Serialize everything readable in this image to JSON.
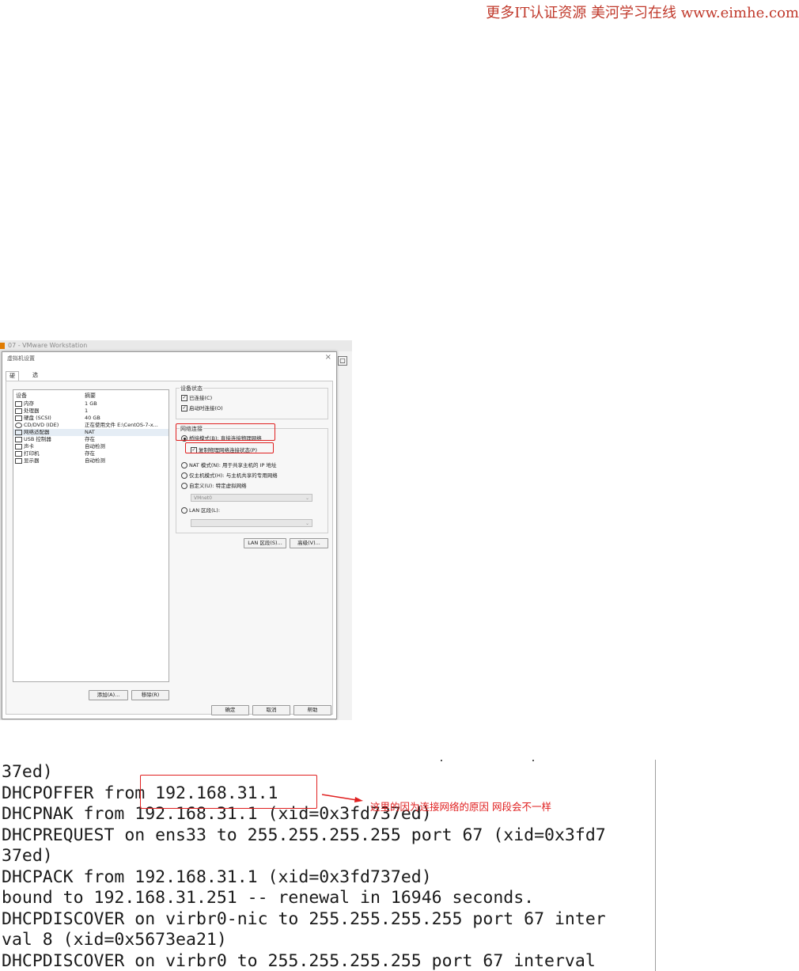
{
  "watermark": "更多IT认证资源 美河学习在线 www.eimhe.com",
  "vmware": {
    "window_title": "07 - VMware Workstation",
    "dialog_title": "虚拟机设置",
    "tabs": [
      "硬件",
      "选项"
    ],
    "device_header": "设备",
    "summary_header": "摘要",
    "devices": [
      {
        "name": "内存",
        "summary": "1 GB",
        "icon": "memory-icon"
      },
      {
        "name": "处理器",
        "summary": "1",
        "icon": "cpu-icon"
      },
      {
        "name": "硬盘 (SCSI)",
        "summary": "40 GB",
        "icon": "hard-disk-icon"
      },
      {
        "name": "CD/DVD (IDE)",
        "summary": "正在使用文件 E:\\CentOS-7-x...",
        "icon": "cd-dvd-icon"
      },
      {
        "name": "网络适配器",
        "summary": "NAT",
        "icon": "network-adapter-icon",
        "selected": true
      },
      {
        "name": "USB 控制器",
        "summary": "存在",
        "icon": "usb-icon"
      },
      {
        "name": "声卡",
        "summary": "自动检测",
        "icon": "sound-card-icon"
      },
      {
        "name": "打印机",
        "summary": "存在",
        "icon": "printer-icon"
      },
      {
        "name": "显示器",
        "summary": "自动检测",
        "icon": "display-icon"
      }
    ],
    "add_button": "添加(A)...",
    "remove_button": "移除(R)",
    "device_status": {
      "label": "设备状态",
      "connected": "已连接(C)",
      "connect_at_power_on": "启动时连接(O)"
    },
    "network_connection": {
      "label": "网络连接",
      "bridged": "桥接模式(B): 直接连接物理网络",
      "replicate": "复制物理网络连接状态(P)",
      "nat": "NAT 模式(N): 用于共享主机的 IP 地址",
      "host_only": "仅主机模式(H): 与主机共享的专用网络",
      "custom": "自定义(U): 特定虚拟网络",
      "custom_value": "VMnet0",
      "lan_segment": "LAN 区段(L):"
    },
    "lan_segments_button": "LAN 区段(S)...",
    "advanced_button": "高级(V)...",
    "ok_button": "确定",
    "cancel_button": "取消",
    "help_button": "帮助"
  },
  "terminal": {
    "lines": [
      "37ed)",
      "DHCPOFFER from 192.168.31.1",
      "DHCPNAK from 192.168.31.1 (xid=0x3fd737ed)",
      "DHCPREQUEST on ens33 to 255.255.255.255 port 67 (xid=0x3fd7",
      "37ed)",
      "DHCPACK from 192.168.31.1 (xid=0x3fd737ed)",
      "bound to 192.168.31.251 -- renewal in 16946 seconds.",
      "DHCPDISCOVER on virbr0-nic to 255.255.255.255 port 67 inter",
      "val 8 (xid=0x5673ea21)",
      "DHCPDISCOVER on virbr0 to 255.255.255.255 port 67 interval"
    ],
    "annotation": "这里的因为连接网络的原因  网段会不一样"
  },
  "colors": {
    "highlight_red": "#e02020",
    "watermark_red": "#c0392b"
  }
}
